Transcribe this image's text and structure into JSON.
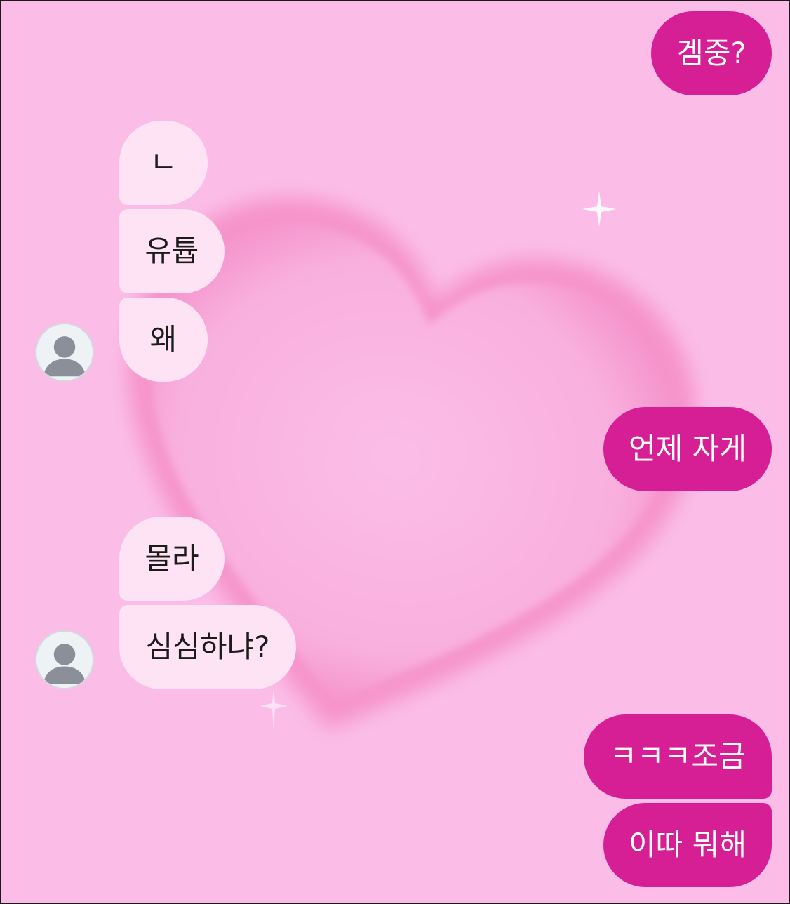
{
  "chat": {
    "messages": [
      {
        "sender": "me",
        "text": "겜중?"
      },
      {
        "sender": "friend",
        "text": "ㄴ"
      },
      {
        "sender": "friend",
        "text": "유튭"
      },
      {
        "sender": "friend",
        "text": "왜"
      },
      {
        "sender": "me",
        "text": "언제 자게"
      },
      {
        "sender": "friend",
        "text": "몰라"
      },
      {
        "sender": "friend",
        "text": "심심하냐?"
      },
      {
        "sender": "me",
        "text": "ㅋㅋㅋ조금"
      },
      {
        "sender": "me",
        "text": "이따 뭐해"
      }
    ]
  },
  "avatar_icon": "default-person-icon",
  "colors": {
    "background": "#fbbde8",
    "outgoing_bubble": "#d61f95",
    "incoming_bubble": "#fde3f4",
    "heart": "#f58fc8"
  }
}
